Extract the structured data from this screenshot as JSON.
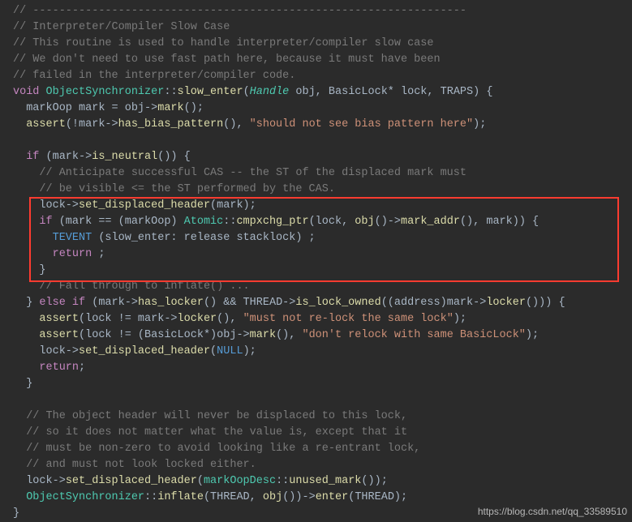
{
  "code": {
    "c1": "// ------------------------------------------------------------------",
    "c2": "// Interpreter/Compiler Slow Case",
    "c3": "// This routine is used to handle interpreter/compiler slow case",
    "c4": "// We don't need to use fast path here, because it must have been",
    "c5": "// failed in the interpreter/compiler code.",
    "kw_void": "void",
    "cls_os": "ObjectSynchronizer",
    "fn_slow_enter": "slow_enter",
    "typ_handle": "Handle",
    "p_obj": " obj, BasicLock* lock, TRAPS) {",
    "l7": "  markOop mark = obj->",
    "fn_mark": "mark",
    "l7b": "();",
    "fn_assert": "assert",
    "l8a": "(!mark->",
    "fn_hbp": "has_bias_pattern",
    "l8b": "(), ",
    "str1": "\"should not see bias pattern here\"",
    "l8c": ");",
    "kw_if": "if",
    "l10a": " (mark->",
    "fn_isn": "is_neutral",
    "l10b": "()) {",
    "c6": "    // Anticipate successful CAS -- the ST of the displaced mark must",
    "c7": "    // be visible <= the ST performed by the CAS.",
    "l13a": "    lock->",
    "fn_sdh": "set_displaced_header",
    "l13b": "(mark);",
    "l14a": " (mark == (markOop) ",
    "ns_atomic": "Atomic",
    "fn_cmp": "cmpxchg_ptr",
    "l14b": "(lock, ",
    "fn_obj": "obj",
    "l14c": "()->",
    "fn_ma": "mark_addr",
    "l14d": "(), mark)) {",
    "const_tevent": "TEVENT",
    "l15a": " (slow_enter: release stacklock) ;",
    "kw_return": "return",
    "l16a": " ;",
    "l17": "    }",
    "c8": "    // Fall through to inflate() ...",
    "l19a": "  } ",
    "kw_else": "else",
    "l19b": " (mark->",
    "fn_hlk": "has_locker",
    "l19c": "() && THREAD->",
    "fn_ilo": "is_lock_owned",
    "l19d": "((address)mark->",
    "fn_lkr": "locker",
    "l19e": "())) {",
    "l20a": "(lock != mark->",
    "l20b": "(), ",
    "str2": "\"must not re-lock the same lock\"",
    "l20c": ");",
    "l21a": "(lock != (BasicLock*)obj->",
    "l21b": "(), ",
    "str3": "\"don't relock with same BasicLock\"",
    "l21c": ");",
    "l22a": "    lock->",
    "l22b": "(",
    "const_null": "NULL",
    "l22c": ");",
    "l23a": ";",
    "l24": "  }",
    "c9": "  // The object header will never be displaced to this lock,",
    "c10": "  // so it does not matter what the value is, except that it",
    "c11": "  // must be non-zero to avoid looking like a re-entrant lock,",
    "c12": "  // and must not look locked either.",
    "l29a": "  lock->",
    "l29b": "(",
    "cls_mod": "markOopDesc",
    "fn_um": "unused_mark",
    "l29c": "());",
    "fn_inf": "inflate",
    "l30a": "(THREAD, ",
    "l30b": "())->",
    "fn_ent": "enter",
    "l30c": "(THREAD);",
    "l31": "}"
  },
  "watermark": "https://blog.csdn.net/qq_33589510"
}
